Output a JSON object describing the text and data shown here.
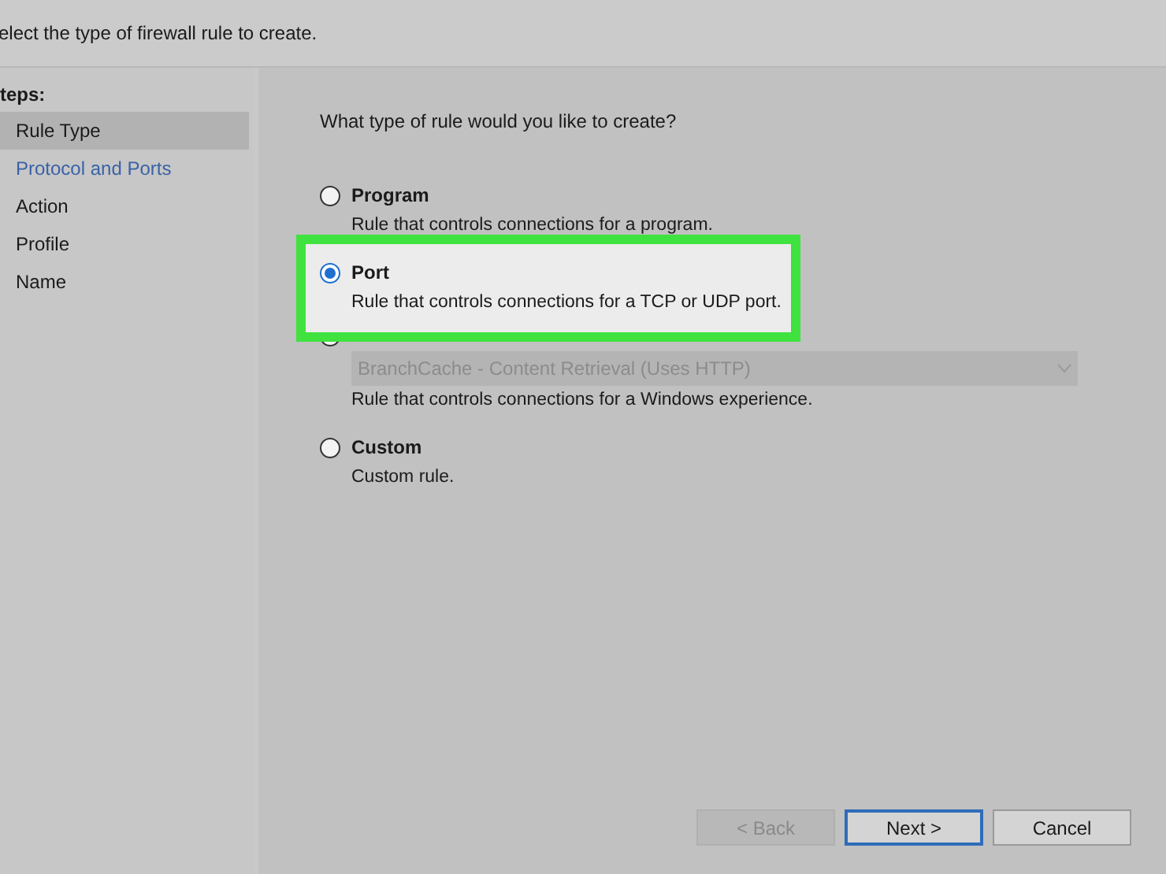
{
  "header": {
    "subtitle": "elect the type of firewall rule to create."
  },
  "steps": {
    "title": "teps:",
    "items": [
      {
        "label": "Rule Type",
        "selected": true,
        "link": false
      },
      {
        "label": "Protocol and Ports",
        "selected": false,
        "link": true
      },
      {
        "label": "Action",
        "selected": false,
        "link": false
      },
      {
        "label": "Profile",
        "selected": false,
        "link": false
      },
      {
        "label": "Name",
        "selected": false,
        "link": false
      }
    ]
  },
  "question": "What type of rule would you like to create?",
  "options": [
    {
      "kind": "plain",
      "label": "Program",
      "description": "Rule that controls connections for a program.",
      "selected": false
    },
    {
      "kind": "plain",
      "label": "Port",
      "description": "Rule that controls connections for a TCP or UDP port.",
      "selected": true,
      "highlighted": true
    },
    {
      "kind": "dropdown",
      "value": "BranchCache - Content Retrieval (Uses HTTP)",
      "disabled": true,
      "description": "Rule that controls connections for a Windows experience.",
      "selected": false
    },
    {
      "kind": "plain",
      "label": "Custom",
      "description": "Custom rule.",
      "selected": false
    }
  ],
  "buttons": [
    {
      "label": "< Back",
      "disabled": true,
      "default": false
    },
    {
      "label": "Next >",
      "disabled": false,
      "default": true
    },
    {
      "label": "Cancel",
      "disabled": false,
      "default": false
    }
  ]
}
